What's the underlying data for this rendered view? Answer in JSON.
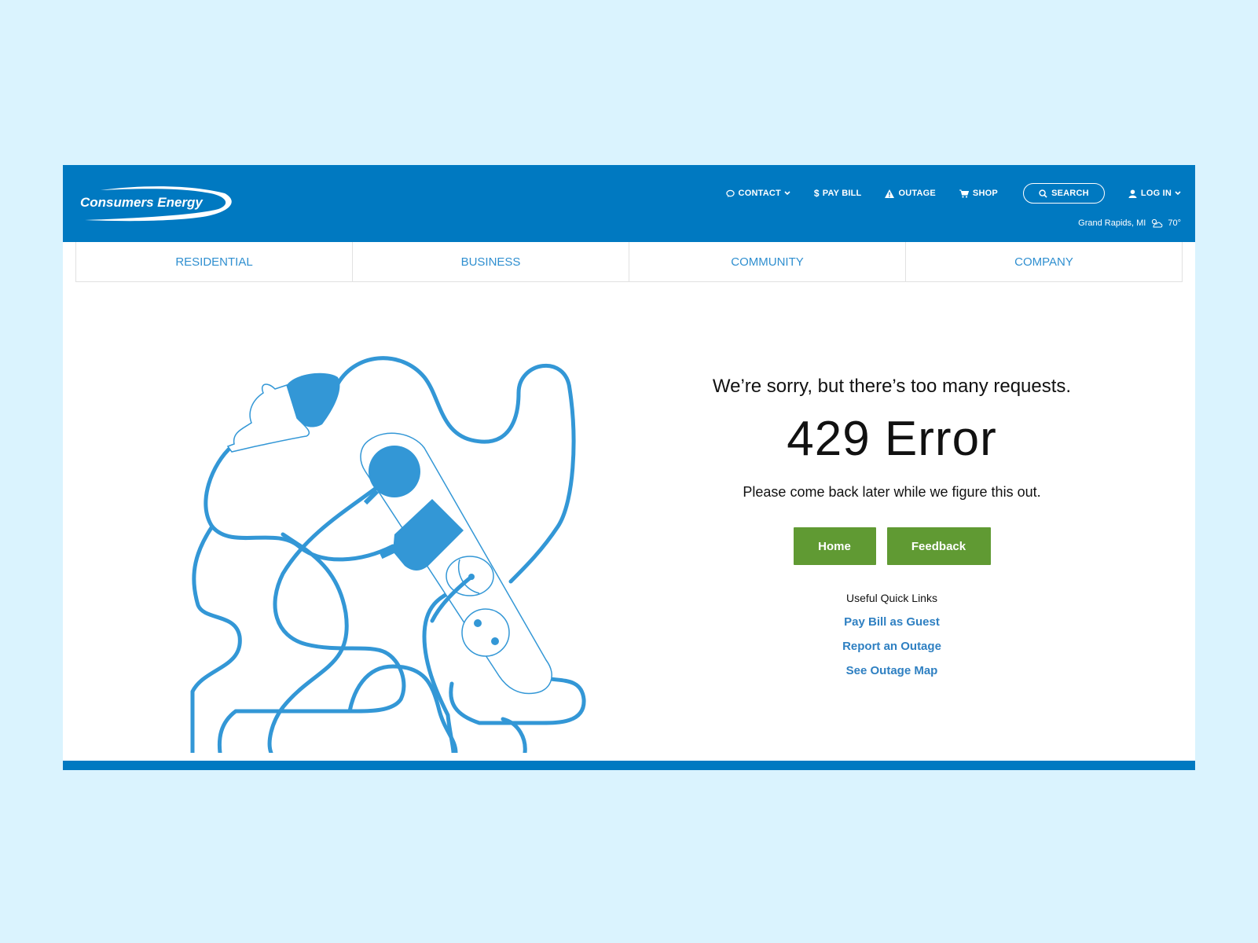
{
  "brand": {
    "name": "Consumers Energy"
  },
  "utility_nav": {
    "contact": "CONTACT",
    "pay_bill": "PAY BILL",
    "outage": "OUTAGE",
    "shop": "SHOP",
    "search": "SEARCH",
    "login": "LOG IN"
  },
  "location": {
    "city": "Grand Rapids, MI",
    "temperature": "70°",
    "weather_icon": "partly-cloudy-icon"
  },
  "main_nav": [
    "RESIDENTIAL",
    "BUSINESS",
    "COMMUNITY",
    "COMPANY"
  ],
  "error": {
    "headline": "We’re sorry, but there’s too many requests.",
    "code": "429 Error",
    "message": "Please come back later while we figure this out."
  },
  "buttons": {
    "home": "Home",
    "feedback": "Feedback"
  },
  "quick_links": {
    "title": "Useful Quick Links",
    "items": [
      "Pay Bill as Guest",
      "Report an Outage",
      "See Outage Map"
    ]
  },
  "colors": {
    "brand_blue": "#0079c1",
    "nav_text": "#2f8fd0",
    "button_green": "#609a33",
    "illustration_blue": "#3397d6",
    "page_background": "#daf3fe"
  }
}
